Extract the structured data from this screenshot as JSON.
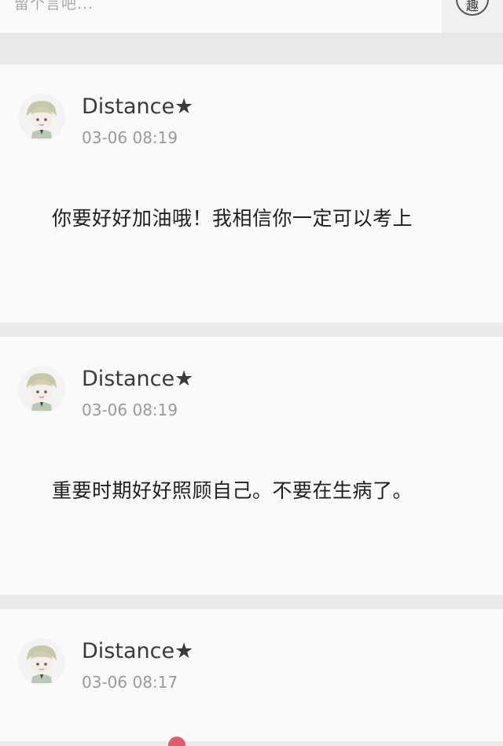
{
  "comment_bar": {
    "placeholder": "留个言吧...",
    "button_char": "趣"
  },
  "comments": [
    {
      "author": "Distance★",
      "time": "03-06 08:19",
      "text": "你要好好加油哦！我相信你一定可以考上"
    },
    {
      "author": "Distance★",
      "time": "03-06 08:19",
      "text": "重要时期好好照顾自己。不要在生病了。"
    },
    {
      "author": "Distance★",
      "time": "03-06 08:17",
      "text": ""
    }
  ],
  "colors": {
    "page_bg": "#e9e9e9",
    "card_bg": "#fafafa",
    "author": "#3a3a3a",
    "time": "#9a9a9a",
    "body_text": "#1e1e1e",
    "accent": "#e35b6b"
  }
}
